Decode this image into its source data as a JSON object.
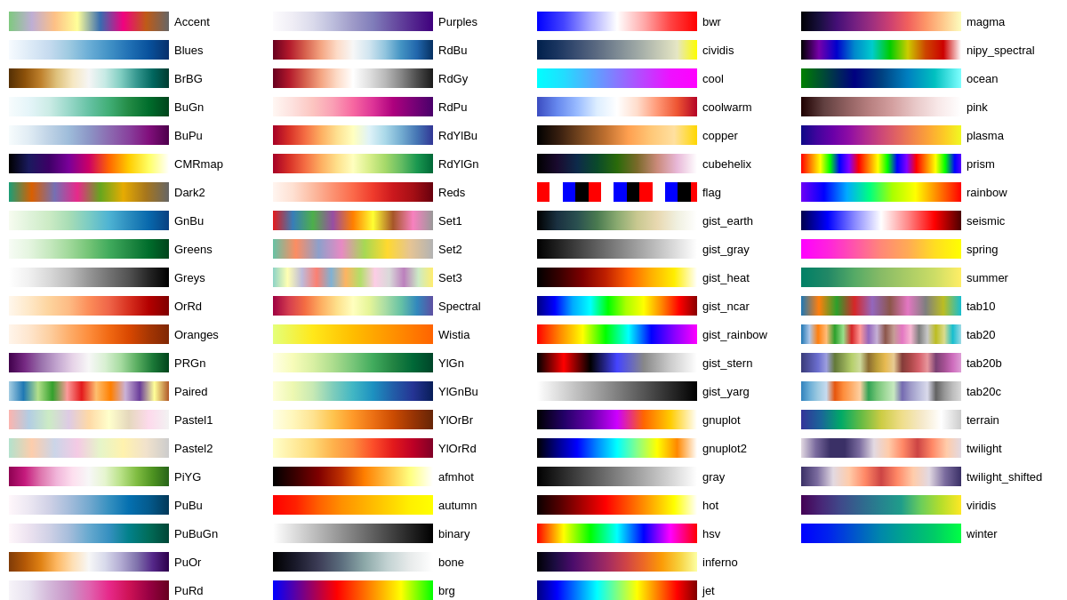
{
  "colormaps": [
    {
      "name": "Accent",
      "gradient": "linear-gradient(to right, #7fc97f, #beaed4, #fdc086, #ffff99, #386cb0, #f0027f, #bf5b17, #666666)"
    },
    {
      "name": "Blues",
      "gradient": "linear-gradient(to right, #f7fbff, #deebf7, #c6dbef, #9ecae1, #6baed6, #4292c6, #2171b5, #08519c, #08306b)"
    },
    {
      "name": "BrBG",
      "gradient": "linear-gradient(to right, #543005, #8c510a, #bf812d, #dfc27d, #f6e8c3, #f5f5f5, #c7eae5, #80cdc1, #35978f, #01665e, #003c30)"
    },
    {
      "name": "BuGn",
      "gradient": "linear-gradient(to right, #f7fcfd, #e5f5f9, #ccece6, #99d8c9, #66c2a4, #41ae76, #238b45, #006d2c, #00441b)"
    },
    {
      "name": "BuPu",
      "gradient": "linear-gradient(to right, #f7fcfd, #e0ecf4, #bfd3e6, #9ebcda, #8c96c6, #8c6bb1, #88419d, #810f7c, #4d004b)"
    },
    {
      "name": "CMRmap",
      "gradient": "linear-gradient(to right, #000000, #1a1a5e, #3d0066, #7a0099, #cc0066, #ff6600, #ffcc00, #ffff66, #ffffff)"
    },
    {
      "name": "Dark2",
      "gradient": "linear-gradient(to right, #1b9e77, #d95f02, #7570b3, #e7298a, #66a61e, #e6ab02, #a6761d, #666666)"
    },
    {
      "name": "GnBu",
      "gradient": "linear-gradient(to right, #f7fcf0, #e0f3db, #ccebc5, #a8ddb5, #7bccc4, #4eb3d3, #2b8cbe, #0868ac, #084081)"
    },
    {
      "name": "Greens",
      "gradient": "linear-gradient(to right, #f7fcf5, #e5f5e0, #c7e9c0, #a1d99b, #74c476, #41ab5d, #238b45, #006d2c, #00441b)"
    },
    {
      "name": "Greys",
      "gradient": "linear-gradient(to right, #ffffff, #f0f0f0, #d9d9d9, #bdbdbd, #969696, #737373, #525252, #252525, #000000)"
    },
    {
      "name": "OrRd",
      "gradient": "linear-gradient(to right, #fff7ec, #fee8c8, #fdd49e, #fdbb84, #fc8d59, #ef6548, #d7301f, #b30000, #7f0000)"
    },
    {
      "name": "Oranges",
      "gradient": "linear-gradient(to right, #fff5eb, #fee6ce, #fdd0a2, #fdae6b, #fd8d3c, #f16913, #d94801, #a63603, #7f2704)"
    },
    {
      "name": "PRGn",
      "gradient": "linear-gradient(to right, #40004b, #762a83, #9970ab, #c2a5cf, #e7d4e8, #f7f7f7, #d9f0d3, #a6dba0, #5aae61, #1b7837, #00441b)"
    },
    {
      "name": "Paired",
      "gradient": "linear-gradient(to right, #a6cee3, #1f78b4, #b2df8a, #33a02c, #fb9a99, #e31a1c, #fdbf6f, #ff7f00, #cab2d6, #6a3d9a, #ffff99, #b15928)"
    },
    {
      "name": "Pastel1",
      "gradient": "linear-gradient(to right, #fbb4ae, #b3cde3, #ccebc5, #decbe4, #fed9a6, #ffffcc, #e5d8bd, #fddaec, #f2f2f2)"
    },
    {
      "name": "Pastel2",
      "gradient": "linear-gradient(to right, #b3e2cd, #fdcdac, #cbd5e8, #f4cae4, #e6f5c9, #fff2ae, #f1e2cc, #cccccc)"
    },
    {
      "name": "PiYG",
      "gradient": "linear-gradient(to right, #8e0152, #c51b7d, #de77ae, #f1b6da, #fde0ef, #f7f7f7, #e6f5d0, #b8e186, #7fbc41, #4d9221, #276419)"
    },
    {
      "name": "PuBu",
      "gradient": "linear-gradient(to right, #fff7fb, #ece7f2, #d0d1e6, #a6bddb, #74a9cf, #3690c0, #0570b0, #045a8d, #023858)"
    },
    {
      "name": "PuBuGn",
      "gradient": "linear-gradient(to right, #fff7fb, #ece2f0, #d0d1e6, #a6bddb, #67a9cf, #3690c0, #02818a, #016c59, #014636)"
    },
    {
      "name": "PuOr",
      "gradient": "linear-gradient(to right, #7f3b08, #b35806, #e08214, #fdb863, #fee0b6, #f7f7f7, #d8daeb, #b2abd2, #8073ac, #542788, #2d004b)"
    },
    {
      "name": "PuRd",
      "gradient": "linear-gradient(to right, #f7f4f9, #e7e1ef, #d4b9da, #c994c7, #df65b0, #e7298a, #ce1256, #980043, #67001f)"
    },
    {
      "name": "Purples",
      "gradient": "linear-gradient(to right, #fcfbfd, #efedf5, #dadaeb, #bcbddc, #9e9ac8, #807dba, #6a51a3, #54278f, #3f007d)"
    },
    {
      "name": "RdBu",
      "gradient": "linear-gradient(to right, #67001f, #b2182b, #d6604d, #f4a582, #fddbc7, #f7f7f7, #d1e5f0, #92c5de, #4393c3, #2166ac, #053061)"
    },
    {
      "name": "RdGy",
      "gradient": "linear-gradient(to right, #67001f, #b2182b, #d6604d, #f4a582, #fddbc7, #ffffff, #e0e0e0, #bababa, #878787, #4d4d4d, #1a1a1a)"
    },
    {
      "name": "RdPu",
      "gradient": "linear-gradient(to right, #fff7f3, #fde0dd, #fcc5c0, #fa9fb5, #f768a1, #dd3497, #ae017e, #7a0177, #49006a)"
    },
    {
      "name": "RdYlBu",
      "gradient": "linear-gradient(to right, #a50026, #d73027, #f46d43, #fdae61, #fee090, #ffffbf, #e0f3f8, #abd9e9, #74add1, #4575b4, #313695)"
    },
    {
      "name": "RdYlGn",
      "gradient": "linear-gradient(to right, #a50026, #d73027, #f46d43, #fdae61, #fee08b, #ffffbf, #d9ef8b, #a6d96a, #66bd63, #1a9850, #006837)"
    },
    {
      "name": "Reds",
      "gradient": "linear-gradient(to right, #fff5f0, #fee0d2, #fcbba1, #fc9272, #fb6a4a, #ef3b2c, #cb181d, #a50f15, #67000d)"
    },
    {
      "name": "Set1",
      "gradient": "linear-gradient(to right, #e41a1c, #377eb8, #4daf4a, #984ea3, #ff7f00, #ffff33, #a65628, #f781bf, #999999)"
    },
    {
      "name": "Set2",
      "gradient": "linear-gradient(to right, #66c2a5, #fc8d62, #8da0cb, #e78ac3, #a6d854, #ffd92f, #e5c494, #b3b3b3)"
    },
    {
      "name": "Set3",
      "gradient": "linear-gradient(to right, #8dd3c7, #ffffb3, #bebada, #fb8072, #80b1d3, #fdb462, #b3de69, #fccde5, #d9d9d9, #bc80bd, #ccebc5, #ffed6f)"
    },
    {
      "name": "Spectral",
      "gradient": "linear-gradient(to right, #9e0142, #d53e4f, #f46d43, #fdae61, #fee08b, #ffffbf, #e6f598, #abdda4, #66c2a5, #3288bd, #5e4fa2)"
    },
    {
      "name": "Wistia",
      "gradient": "linear-gradient(to right, #e4ff7a, #ffe81a, #ffbd00, #ff9100, #ff6300)"
    },
    {
      "name": "YlGn",
      "gradient": "linear-gradient(to right, #ffffe5, #f7fcb9, #d9f0a3, #addd8e, #78c679, #41ab5d, #238443, #006837, #004529)"
    },
    {
      "name": "YlGnBu",
      "gradient": "linear-gradient(to right, #ffffd9, #edf8b1, #c7e9b4, #7fcdbb, #41b6c4, #1d91c0, #225ea8, #253494, #081d58)"
    },
    {
      "name": "YlOrBr",
      "gradient": "linear-gradient(to right, #ffffe5, #fff7bc, #fee391, #fec44f, #fe9929, #ec7014, #cc4c02, #993404, #662506)"
    },
    {
      "name": "YlOrRd",
      "gradient": "linear-gradient(to right, #ffffcc, #ffeda0, #fed976, #feb24c, #fd8d3c, #fc4e2a, #e31a1c, #bd0026, #800026)"
    },
    {
      "name": "afmhot",
      "gradient": "linear-gradient(to right, #000000, #3c0000, #7f0000, #bf3000, #ff7f00, #ffbf40, #ffff80, #ffffff)"
    },
    {
      "name": "autumn",
      "gradient": "linear-gradient(to right, #ff0000, #ff2000, #ff6000, #ff9000, #ffb000, #ffd000, #fff000, #ffff00)"
    },
    {
      "name": "binary",
      "gradient": "linear-gradient(to right, #ffffff, #cccccc, #999999, #666666, #333333, #000000)"
    },
    {
      "name": "bone",
      "gradient": "linear-gradient(to right, #000000, #1a1a2b, #3d3d57, #5c6e7e, #8ca8a8, #c2d2d2, #e8ebeb, #ffffff)"
    },
    {
      "name": "brg",
      "gradient": "linear-gradient(to right, #0000ff, #7f007f, #ff0000, #ff7f00, #ffff00, #00ff00)"
    },
    {
      "name": "bwr",
      "gradient": "linear-gradient(to right, #0000ff, #4444ff, #aaaaff, #ffffff, #ffaaaa, #ff4444, #ff0000)"
    },
    {
      "name": "cividis",
      "gradient": "linear-gradient(to right, #00204c, #1a3560, #3b4f72, #5c6b82, #7d8a94, #9ea8a5, #c2c7b5, #e5e6c4, #fdfd00)"
    },
    {
      "name": "cool",
      "gradient": "linear-gradient(to right, #00ffff, #22ddff, #55aaff, #8877ff, #bb44ff, #ee11ff, #ff00ff)"
    },
    {
      "name": "coolwarm",
      "gradient": "linear-gradient(to right, #3b4cc0, #6688ee, #99bbff, #ddeeff, #ffffff, #ffddcc, #ff9977, #ee5533, #b40426)"
    },
    {
      "name": "copper",
      "gradient": "linear-gradient(to right, #000000, #3a2010, #7d4a20, #bf7030, #ffa050, #ffc878, #ffe0a0, #ffd700)"
    },
    {
      "name": "cubehelix",
      "gradient": "linear-gradient(to right, #000000, #1a0a2e, #0d2a4a, #0a4a2a, #2a6a0a, #7a6a2a, #ca8a7a, #e8b8d8, #ffffff)"
    },
    {
      "name": "flag",
      "gradient": "repeating-linear-gradient(to right, #ff0000 0%, #ff0000 8%, #ffffff 8%, #ffffff 16%, #0000ff 16%, #0000ff 24%, #000000 24%, #000000 32%)"
    },
    {
      "name": "gist_earth",
      "gradient": "linear-gradient(to right, #000000, #1a3040, #2a5050, #4a7a50, #8aaa70, #c8c890, #e8d8b0, #f0f0e0, #ffffff)"
    },
    {
      "name": "gist_gray",
      "gradient": "linear-gradient(to right, #000000, #333333, #666666, #999999, #cccccc, #ffffff)"
    },
    {
      "name": "gist_heat",
      "gradient": "linear-gradient(to right, #000000, #3a0000, #7f0000, #bf2000, #ff6000, #ffb000, #ffee00, #ffffff)"
    },
    {
      "name": "gist_ncar",
      "gradient": "linear-gradient(to right, #000080, #0000ff, #00aaff, #00ffff, #00ff00, #aaff00, #ffff00, #ff8800, #ff0000, #880000)"
    },
    {
      "name": "gist_rainbow",
      "gradient": "linear-gradient(to right, #ff0000, #ff8800, #ffff00, #00ff00, #00ffff, #0000ff, #8800ff, #ff00ff)"
    },
    {
      "name": "gist_stern",
      "gradient": "linear-gradient(to right, #000000, #ff0000, #000000, #4444ff, #888888, #cccccc, #ffffff)"
    },
    {
      "name": "gist_yarg",
      "gradient": "linear-gradient(to right, #ffffff, #cccccc, #999999, #666666, #333333, #000000)"
    },
    {
      "name": "gnuplot",
      "gradient": "linear-gradient(to right, #000000, #220066, #6600aa, #cc00ff, #ff6600, #ffcc00, #ffffff)"
    },
    {
      "name": "gnuplot2",
      "gradient": "linear-gradient(to right, #000000, #000088, #0000ff, #0088ff, #00ffff, #88ff88, #ffff00, #ff8800, #ffffff)"
    },
    {
      "name": "gray",
      "gradient": "linear-gradient(to right, #000000, #555555, #aaaaaa, #ffffff)"
    },
    {
      "name": "hot",
      "gradient": "linear-gradient(to right, #0b0000, #550000, #aa0000, #ff0000, #ff5500, #ffaa00, #ffff00, #ffffff)"
    },
    {
      "name": "hsv",
      "gradient": "linear-gradient(to right, #ff0000, #ffff00, #00ff00, #00ffff, #0000ff, #ff00ff, #ff0000)"
    },
    {
      "name": "inferno",
      "gradient": "linear-gradient(to right, #000004, #1b0c41, #4a0c6b, #781c6d, #a52c60, #cf4446, #ed6925, #fb9b06, #f7d13d, #fcffa4)"
    },
    {
      "name": "jet",
      "gradient": "linear-gradient(to right, #000080, #0000ff, #0080ff, #00ffff, #80ff80, #ffff00, #ff8000, #ff0000, #800000)"
    },
    {
      "name": "magma",
      "gradient": "linear-gradient(to right, #000004, #180f3d, #440f76, #721f81, #9e2f7f, #cd4071, #f1605d, #fd9668, #feca8d, #fcfdbf)"
    },
    {
      "name": "nipy_spectral",
      "gradient": "linear-gradient(to right, #000000, #7700aa, #0000cc, #0088cc, #00cccc, #00cc00, #cccc00, #cc4400, #cc0000, #ffffff)"
    },
    {
      "name": "ocean",
      "gradient": "linear-gradient(to right, #008000, #004040, #000080, #004080, #0080c0, #00c0c0, #80ffff)"
    },
    {
      "name": "pink",
      "gradient": "linear-gradient(to right, #1e0000, #614040, #906060, #b88080, #d4a0a0, #e8c8c8, #f8e8e8, #ffffff)"
    },
    {
      "name": "plasma",
      "gradient": "linear-gradient(to right, #0d0887, #41049d, #6a00a8, #8f0da4, #b12a90, #cc4778, #e16462, #f2844b, #fca636, #fccd25, #f0f921)"
    },
    {
      "name": "prism",
      "gradient": "repeating-linear-gradient(to right, #ff0000 0%, #ff8000 6%, #ffff00 12%, #00ff00 18%, #0000ff 24%, #8000ff 30%, #ff0000 36%)"
    },
    {
      "name": "rainbow",
      "gradient": "linear-gradient(to right, #6e00f5, #0000ff, #00aaff, #00ff80, #aaff00, #ffff00, #ff8000, #ff0000)"
    },
    {
      "name": "seismic",
      "gradient": "linear-gradient(to right, #00004c, #0000ff, #8888ff, #ffffff, #ff8888, #ff0000, #4c0000)"
    },
    {
      "name": "spring",
      "gradient": "linear-gradient(to right, #ff00ff, #ff22dd, #ff55aa, #ff8877, #ffaa55, #ffdd22, #ffff00)"
    },
    {
      "name": "summer",
      "gradient": "linear-gradient(to right, #008066, #228866, #55aa66, #88bb66, #aacc66, #ccdd66, #ffee66)"
    },
    {
      "name": "tab10",
      "gradient": "linear-gradient(to right, #1f77b4, #ff7f0e, #2ca02c, #d62728, #9467bd, #8c564b, #e377c2, #7f7f7f, #bcbd22, #17becf)"
    },
    {
      "name": "tab20",
      "gradient": "linear-gradient(to right, #1f77b4, #aec7e8, #ff7f0e, #ffbb78, #2ca02c, #98df8a, #d62728, #ff9896, #9467bd, #c5b0d5, #8c564b, #c49c94, #e377c2, #f7b6d2, #7f7f7f, #c7c7c7, #bcbd22, #dbdb8d, #17becf, #9edae5)"
    },
    {
      "name": "tab20b",
      "gradient": "linear-gradient(to right, #393b79, #5254a3, #6b6ecf, #9c9ede, #637939, #8ca252, #b5cf6b, #cedb9c, #8c6d31, #bd9e39, #e7ba52, #e7cb94, #843c39, #ad494a, #d6616b, #e7969c, #7b4173, #a55194, #ce6dbd, #de9ed6)"
    },
    {
      "name": "tab20c",
      "gradient": "linear-gradient(to right, #3182bd, #6baed6, #9ecae1, #c6dbef, #e6550d, #fd8d3c, #fdae6b, #fdd0a2, #31a354, #74c476, #a1d99b, #c7e9c0, #756bb1, #9e9ac8, #bcbddc, #dadaeb, #636363, #969696, #bdbdbd, #d9d9d9)"
    },
    {
      "name": "terrain",
      "gradient": "linear-gradient(to right, #333399, #1a6699, #00aa66, #66bb44, #cccc44, #eedd88, #f5e8c8, #ffffff, #cccccc)"
    },
    {
      "name": "twilight",
      "gradient": "linear-gradient(to right, #e2d9e2, #7a6b9e, #3a3066, #3a3066, #7a6b9e, #e2d9e2, #ffccaa, #ff8866, #cc4444, #ff8866, #ffccaa, #e2d9e2)"
    },
    {
      "name": "twilight_shifted",
      "gradient": "linear-gradient(to right, #3a3066, #7a6b9e, #e2d9e2, #ffccaa, #ff8866, #cc4444, #ff8866, #ffccaa, #e2d9e2, #7a6b9e, #3a3066)"
    },
    {
      "name": "viridis",
      "gradient": "linear-gradient(to right, #440154, #482777, #3f4a8a, #31678e, #26838f, #1f9d8a, #6cce5a, #b6de2b, #fee825)"
    },
    {
      "name": "winter",
      "gradient": "linear-gradient(to right, #0000ff, #0022ee, #0055cc, #0088aa, #00aa88, #00cc66, #00ff44)"
    }
  ],
  "watermark": "https://blog.csdn.net/gsgbgxp"
}
